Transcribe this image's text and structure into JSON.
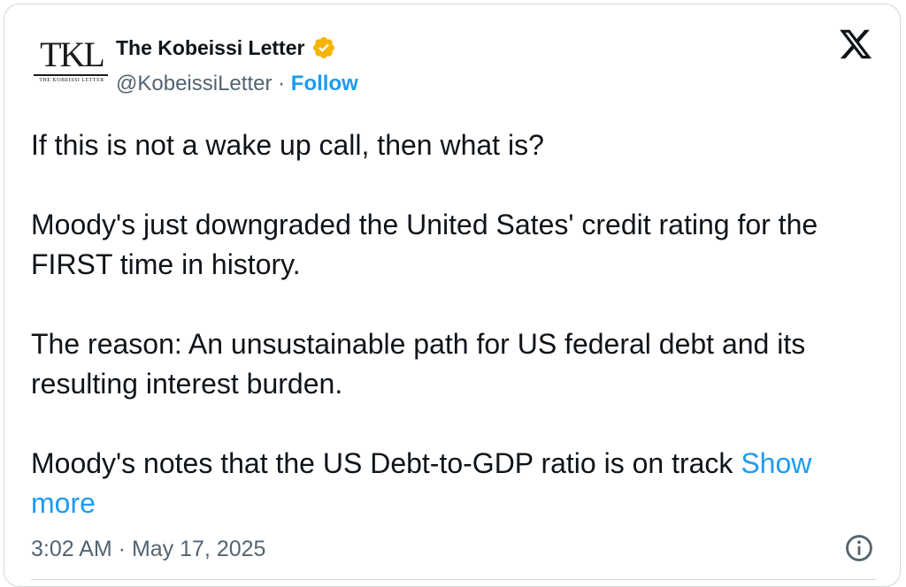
{
  "author": {
    "name": "The Kobeissi Letter",
    "handle": "@KobeissiLetter",
    "separator": "·",
    "follow_label": "Follow",
    "logo_text": "TKL",
    "logo_subtext": "THE KOBEISSI LETTER",
    "verified_color": "#f4b400"
  },
  "tweet": {
    "paragraphs": [
      "If this is not a wake up call, then what is?",
      "Moody's just downgraded the United Sates' credit rating for the FIRST time in history.",
      "The reason: An unsustainable path for US federal debt and its resulting interest burden.",
      "Moody's notes that the US Debt-to-GDP ratio is on track"
    ],
    "show_more_label": "Show more",
    "timestamp": "3:02 AM · May 17, 2025"
  },
  "icons": {
    "platform": "x-logo-icon",
    "verified": "verified-badge-icon",
    "info": "info-icon"
  },
  "colors": {
    "link": "#1d9bf0",
    "secondary_text": "#536471",
    "border": "#cfd9de"
  }
}
